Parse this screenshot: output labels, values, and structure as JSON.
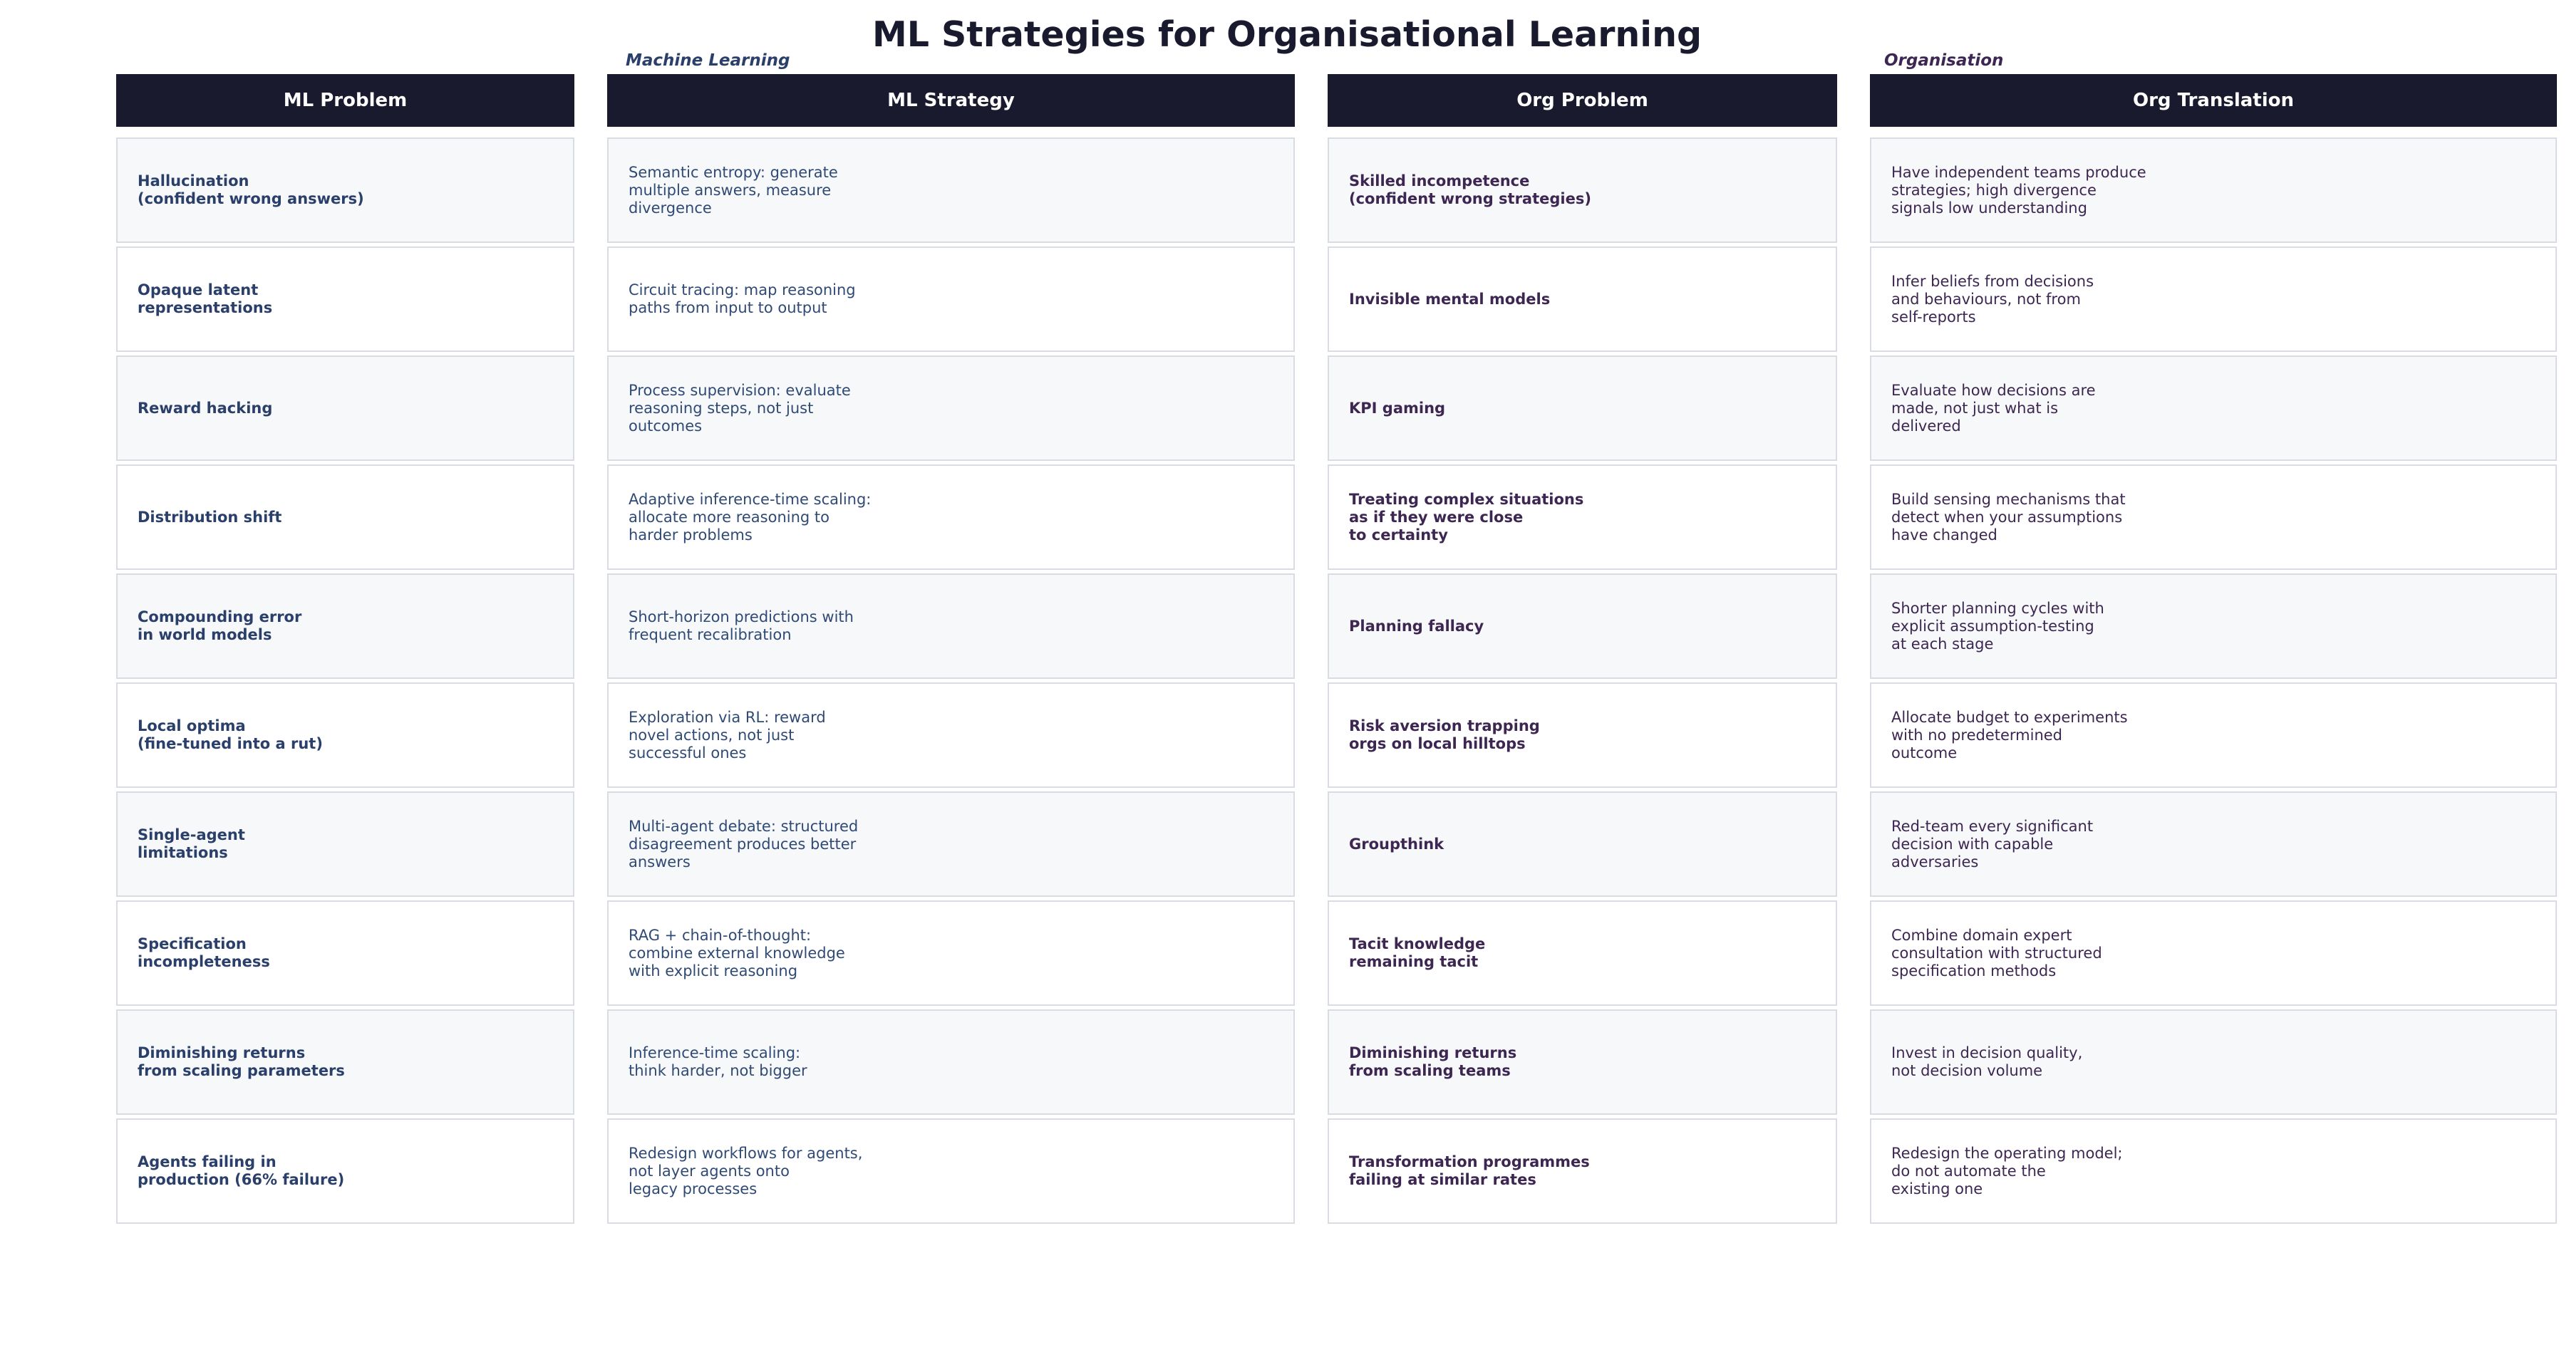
{
  "title": "ML Strategies for Organisational Learning",
  "groups": {
    "ml": "Machine Learning",
    "org": "Organisation"
  },
  "columns": [
    {
      "header": "ML Problem",
      "rows": [
        "Hallucination\n(confident wrong answers)",
        "Opaque latent\nrepresentations",
        "Reward hacking",
        "Distribution shift",
        "Compounding error\nin world models",
        "Local optima\n(fine-tuned into a rut)",
        "Single-agent\nlimitations",
        "Specification\nincompleteness",
        "Diminishing returns\nfrom scaling parameters",
        "Agents failing in\nproduction (66% failure)"
      ]
    },
    {
      "header": "ML Strategy",
      "rows": [
        "Semantic entropy: generate\nmultiple answers, measure\ndivergence",
        "Circuit tracing: map reasoning\npaths from input to output",
        "Process supervision: evaluate\nreasoning steps, not just\noutcomes",
        "Adaptive inference-time scaling:\nallocate more reasoning to\nharder problems",
        "Short-horizon predictions with\nfrequent recalibration",
        "Exploration via RL: reward\nnovel actions, not just\nsuccessful ones",
        "Multi-agent debate: structured\ndisagreement produces better\nanswers",
        "RAG + chain-of-thought:\ncombine external knowledge\nwith explicit reasoning",
        "Inference-time scaling:\nthink harder, not bigger",
        "Redesign workflows for agents,\nnot layer agents onto\nlegacy processes"
      ]
    },
    {
      "header": "Org Problem",
      "rows": [
        "Skilled incompetence\n(confident wrong strategies)",
        "Invisible mental models",
        "KPI gaming",
        "Treating complex situations\nas if they were close\nto certainty",
        "Planning fallacy",
        "Risk aversion trapping\norgs on local hilltops",
        "Groupthink",
        "Tacit knowledge\nremaining tacit",
        "Diminishing returns\nfrom scaling teams",
        "Transformation programmes\nfailing at similar rates"
      ]
    },
    {
      "header": "Org Translation",
      "rows": [
        "Have independent teams produce\nstrategies; high divergence\nsignals low understanding",
        "Infer beliefs from decisions\nand behaviours, not from\nself-reports",
        "Evaluate how decisions are\nmade, not just what is\ndelivered",
        "Build sensing mechanisms that\ndetect when your assumptions\nhave changed",
        "Shorter planning cycles with\nexplicit assumption-testing\nat each stage",
        "Allocate budget to experiments\nwith no predetermined\noutcome",
        "Red-team every significant\ndecision with capable\nadversaries",
        "Combine domain expert\nconsultation with structured\nspecification methods",
        "Invest in decision quality,\nnot decision volume",
        "Redesign the operating model;\ndo not automate the\nexisting one"
      ]
    }
  ],
  "colors": {
    "header_bg": "#1a1a2e",
    "ml_text": "#2a3f6a",
    "org_text": "#3d2752",
    "row_alt_bg": "#f7f8fa",
    "cell_border": "#d9dce2"
  }
}
